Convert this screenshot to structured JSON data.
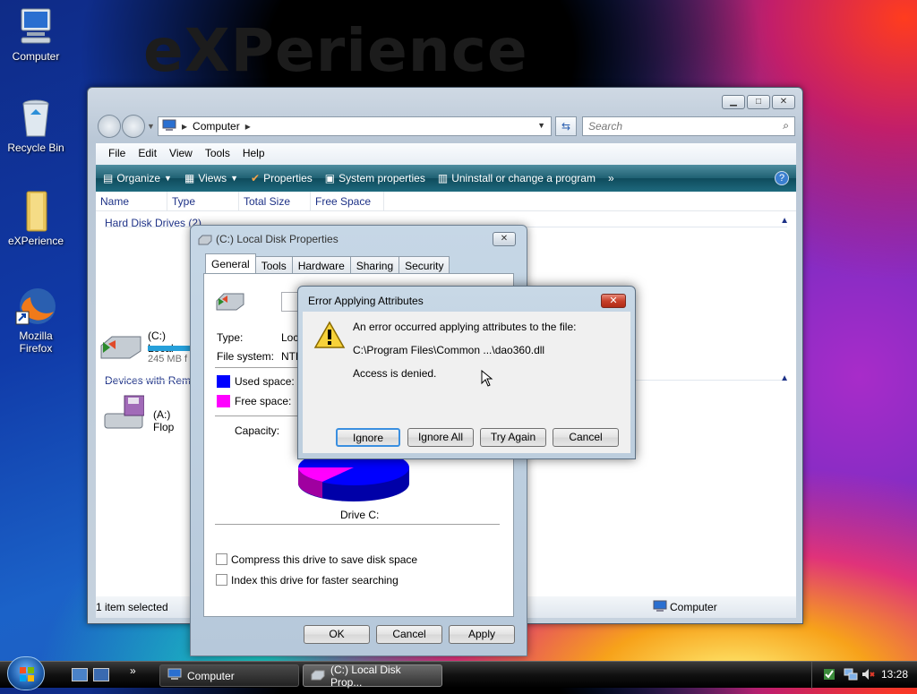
{
  "desktop": {
    "watermark": "eXPerience",
    "icons": [
      {
        "label": "Computer",
        "icon": "computer-icon"
      },
      {
        "label": "Recycle Bin",
        "icon": "recycle-bin-icon"
      },
      {
        "label": "eXPerience",
        "icon": "folder-icon"
      },
      {
        "label_line1": "Mozilla",
        "label_line2": "Firefox",
        "icon": "firefox-icon"
      }
    ]
  },
  "explorer": {
    "address": "Computer",
    "search_placeholder": "Search",
    "menu": [
      "File",
      "Edit",
      "View",
      "Tools",
      "Help"
    ],
    "toolbar": {
      "organize": "Organize",
      "views": "Views",
      "properties": "Properties",
      "system_properties": "System properties",
      "uninstall": "Uninstall or change a program",
      "more": "»"
    },
    "columns": [
      "Name",
      "Type",
      "Total Size",
      "Free Space"
    ],
    "groups": {
      "hdd": "Hard Disk Drives (2)",
      "removable": "Devices with Remo"
    },
    "items": {
      "c_drive": "(C:) Local",
      "c_drive_free": "245 MB f",
      "a_drive": "(A:) Flop"
    },
    "status_left": "1 item selected",
    "status_right": "Computer"
  },
  "properties_dialog": {
    "title": "(C:) Local Disk Properties",
    "tabs": [
      "General",
      "Tools",
      "Hardware",
      "Sharing",
      "Security"
    ],
    "type_label": "Type:",
    "type_value": "Loc",
    "fs_label": "File system:",
    "fs_value": "NTF",
    "used_label": "Used space:",
    "free_label": "Free space:",
    "capacity_label": "Capacity:",
    "drive_label": "Drive C:",
    "compress_label": "Compress this drive to save disk space",
    "index_label": "Index this drive for faster searching",
    "buttons": {
      "ok": "OK",
      "cancel": "Cancel",
      "apply": "Apply"
    },
    "colors": {
      "used": "#0000ff",
      "free": "#ff00ff"
    }
  },
  "error_dialog": {
    "title": "Error Applying Attributes",
    "message": "An error occurred applying attributes to the file:",
    "path": "C:\\Program Files\\Common ...\\dao360.dll",
    "detail": "Access is denied.",
    "buttons": {
      "ignore": "Ignore",
      "ignore_all": "Ignore All",
      "try_again": "Try Again",
      "cancel": "Cancel"
    }
  },
  "taskbar": {
    "quicklaunch_more": "»",
    "tasks": [
      "Computer",
      "(C:) Local Disk Prop..."
    ],
    "clock": "13:28"
  }
}
